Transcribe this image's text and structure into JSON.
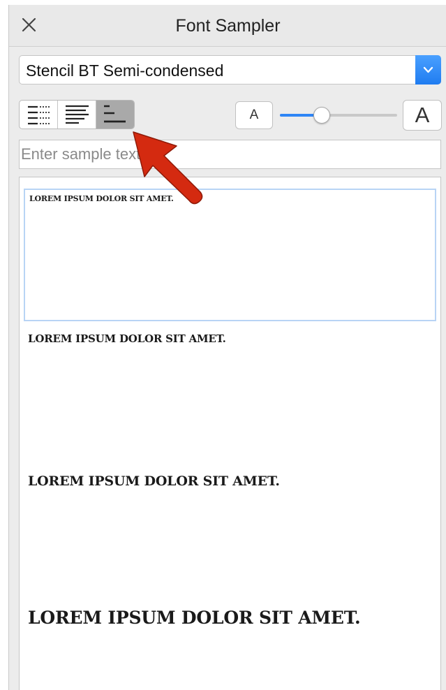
{
  "window": {
    "title": "Font Sampler"
  },
  "font_select": {
    "value": "Stencil BT Semi-condensed"
  },
  "font_size_slider": {
    "value_fraction": 0.36
  },
  "size_buttons": {
    "small_label": "A",
    "large_label": "A"
  },
  "sample_input": {
    "placeholder": "Enter sample text",
    "value": ""
  },
  "samples": [
    {
      "text": "LOREM IPSUM DOLOR SIT AMET."
    },
    {
      "text": "LOREM IPSUM DOLOR SIT AMET."
    },
    {
      "text": "LOREM IPSUM DOLOR SIT AMET."
    },
    {
      "text": "LOREM IPSUM DOLOR SIT AMET."
    }
  ],
  "colors": {
    "accent": "#2f86f6",
    "pointer_arrow": "#d42a10",
    "selected_border": "#b8d4f5"
  },
  "icons": {
    "close": "close-icon",
    "dropdown": "chevron-down-icon",
    "layout_1": "list-dotted-icon",
    "layout_2": "paragraph-lines-icon",
    "layout_3": "short-lines-icon"
  }
}
